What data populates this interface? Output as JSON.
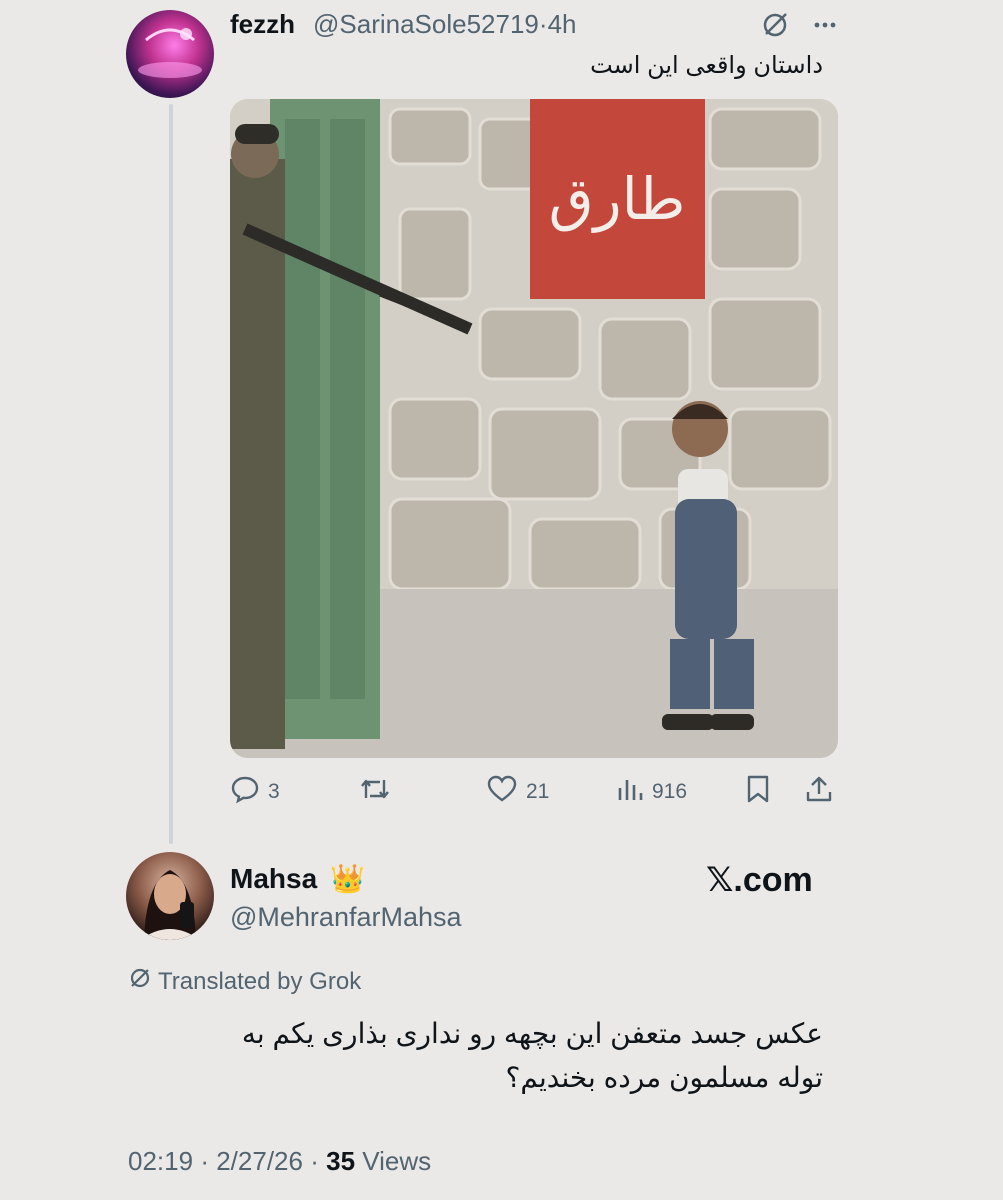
{
  "reply_tweet": {
    "author_name": "fezzh",
    "author_handle": "@SarinaSole52719",
    "separator": "·",
    "time": "4h",
    "text": "داستان واقعی این است",
    "stats": {
      "replies": "3",
      "likes": "21",
      "views": "916"
    },
    "icons": [
      "grok-icon",
      "more-icon",
      "reply-icon",
      "retweet-icon",
      "like-icon",
      "views-icon",
      "bookmark-icon",
      "share-icon"
    ],
    "media_graffiti": "طارق"
  },
  "main_tweet": {
    "author_name": "Mahsa",
    "crown_emoji": "👑",
    "author_handle": "@MehranfarMahsa",
    "watermark": "𝕏.com",
    "translated_label": "Translated by Grok",
    "text_line_1": "عکس جسد متعفن این بچهه رو نداری بذاری یکم به",
    "text_line_2": "توله مسلمون مرده بخندیم؟",
    "time": "02:19",
    "date": "2/27/26",
    "views_count": "35",
    "views_label": "Views",
    "dot": "·"
  },
  "colors": {
    "background": "#ebe9e8",
    "text": "#0f1419",
    "secondary": "#536471",
    "thread_line": "#cfd4d8"
  }
}
